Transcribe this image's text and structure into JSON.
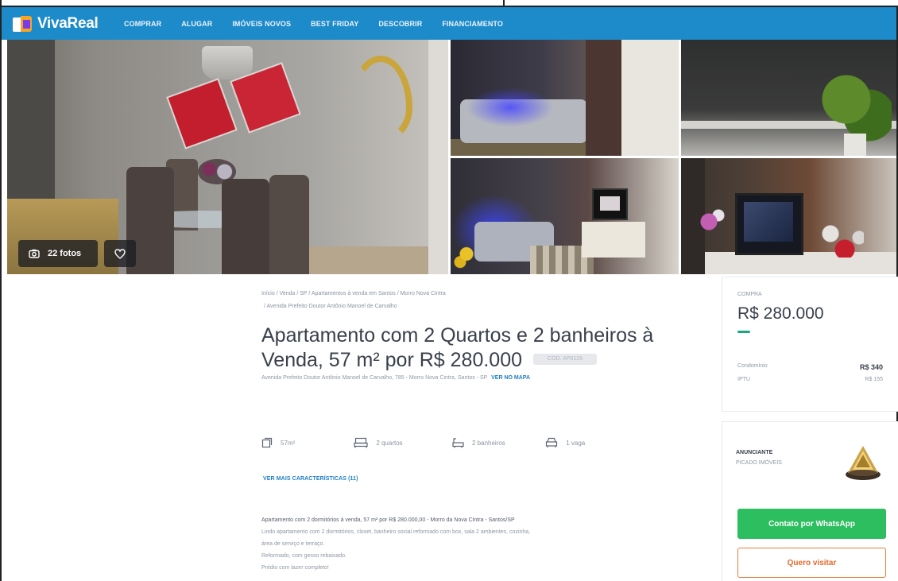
{
  "header": {
    "logo_text": "VivaReal",
    "nav": [
      "COMPRAR",
      "ALUGAR",
      "IMÓVEIS NOVOS",
      "BEST FRIDAY",
      "DESCOBRIR",
      "FINANCIAMENTO"
    ]
  },
  "gallery": {
    "photo_count_label": "22 fotos"
  },
  "listing": {
    "breadcrumb_line1": "Início / Venda / SP / Apartamentos à venda em Santos / Morro Nova Cintra",
    "breadcrumb_line2": "/ Avenida Prefeito Doutor Antônio Manoel de Carvalho",
    "title": "Apartamento com 2 Quartos e 2 banheiros à Venda, 57 m² por R$ 280.000",
    "code": "COD. AP0126",
    "address": "Avenida Prefeito Doutor Antônio Manoel de Carvalho, 785 - Morro Nova Cintra, Santos - SP",
    "map_link": "VER NO MAPA",
    "amenities": {
      "area": "57m²",
      "bedrooms": "2 quartos",
      "bathrooms": "2 banheiros",
      "parking": "1 vaga"
    },
    "more_features": "VER MAIS CARACTERÍSTICAS (11)",
    "description": [
      "Apartamento com 2 dormitórios à venda, 57 m² por R$ 280.000,00 - Morro da Nova Cintra - Santos/SP",
      "Lindo apartamento com 2 dormitórios, closet, banheiro social reformado com box, sala 2 ambientes, cozinha,",
      "área de serviço e terraço.",
      "Reformado, com gesso rebaixado.",
      "Prédio com lazer completo!"
    ]
  },
  "price_card": {
    "label": "COMPRA",
    "price": "R$ 280.000",
    "fee1_label": "Condomínio",
    "fee1_value": "R$ 340",
    "fee2_label": "IPTU",
    "fee2_value": "R$ 155"
  },
  "advertiser": {
    "label": "ANUNCIANTE",
    "name": "PICADO IMÓVEIS",
    "whatsapp_button": "Contato por WhatsApp",
    "visit_button": "Quero visitar"
  },
  "colors": {
    "header_blue": "#1d8ac9",
    "whatsapp_green": "#2dbe60",
    "visit_orange": "#e97c3c",
    "price_accent": "#1aa77c",
    "link_blue": "#1e7fc6"
  }
}
